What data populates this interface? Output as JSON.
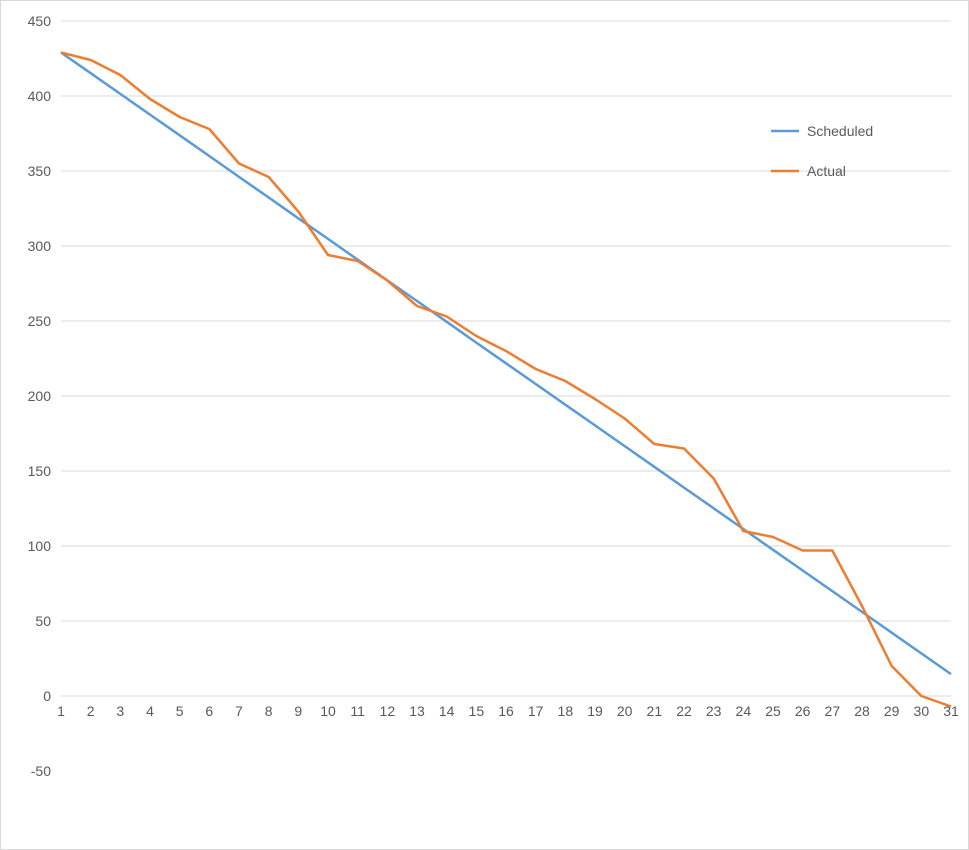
{
  "chart_data": {
    "type": "line",
    "categories": [
      "1",
      "2",
      "3",
      "4",
      "5",
      "6",
      "7",
      "8",
      "9",
      "10",
      "11",
      "12",
      "13",
      "14",
      "15",
      "16",
      "17",
      "18",
      "19",
      "20",
      "21",
      "22",
      "23",
      "24",
      "25",
      "26",
      "27",
      "28",
      "29",
      "30",
      "31"
    ],
    "series": [
      {
        "name": "Scheduled",
        "color": "#5B9BD5",
        "values": [
          429.0,
          415.2,
          401.4,
          387.6,
          373.8,
          360.0,
          346.1,
          332.3,
          318.5,
          304.7,
          290.9,
          277.1,
          263.3,
          249.5,
          235.6,
          221.8,
          208.0,
          194.2,
          180.4,
          166.6,
          152.8,
          138.9,
          125.1,
          111.3,
          97.5,
          83.7,
          69.9,
          56.1,
          42.2,
          28.4,
          14.6
        ]
      },
      {
        "name": "Actual",
        "color": "#ED7D31",
        "values": [
          429,
          424,
          414,
          398,
          386,
          378,
          355,
          346,
          323,
          294,
          290,
          277,
          260,
          253,
          240,
          230,
          218,
          210,
          198,
          185,
          168,
          165,
          145,
          110,
          106,
          97,
          97,
          60,
          20,
          0,
          -7
        ]
      }
    ],
    "xlabel": "",
    "ylabel": "",
    "ylim": [
      -50,
      450
    ],
    "y_ticks": [
      -50,
      0,
      50,
      100,
      150,
      200,
      250,
      300,
      350,
      400,
      450
    ],
    "grid": true,
    "legend_position": "right-inside"
  }
}
